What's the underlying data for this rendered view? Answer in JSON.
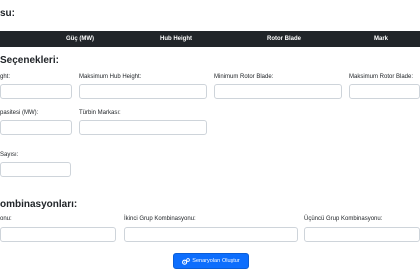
{
  "header": {
    "title": "su:"
  },
  "table": {
    "columns": [
      "Güç (MW)",
      "Hub Height",
      "Rotor Blade",
      "Mark"
    ]
  },
  "options": {
    "title": "Seçenekleri:",
    "labels": {
      "min_hub": "ght:",
      "max_hub": "Maksimum Hub Height:",
      "min_rotor": "Minimum Rotor Blade:",
      "max_rotor": "Maksimum Rotor Blade:",
      "capacity": "pasitesi (MW):",
      "brand": "Türbin Markası:",
      "count": "Sayısı:"
    }
  },
  "combinations": {
    "title": "ombinasyonları:",
    "labels": {
      "first": "onu:",
      "second": "İkinci Grup Kombinasyonu:",
      "third": "Üçüncü Grup Kombinasyonu:"
    }
  },
  "actions": {
    "generate_label": "Senaryoları Oluştur",
    "generate_icon": "gears-icon"
  },
  "colors": {
    "table_header_bg": "#212529",
    "primary": "#0d6efd",
    "field_border": "#ced4da"
  }
}
